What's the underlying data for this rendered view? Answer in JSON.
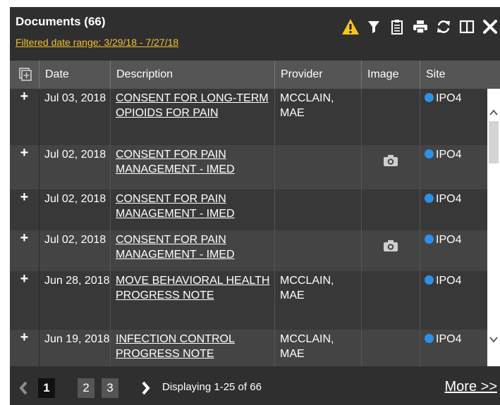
{
  "header": {
    "title": "Documents (66)",
    "filter_text": "Filtered date range: 3/29/18 - 7/27/18"
  },
  "toolbar": {
    "icons": [
      "warning-icon",
      "filter-icon",
      "clipboard-icon",
      "print-icon",
      "refresh-icon",
      "columns-icon",
      "close-icon"
    ],
    "warning_color": "#f5c518"
  },
  "columns": [
    "Date",
    "Description",
    "Provider",
    "Image",
    "Site"
  ],
  "rows": [
    {
      "expand": "+",
      "date": "Jul 03, 2018",
      "description": "CONSENT FOR LONG-TERM OPIOIDS FOR PAIN",
      "provider": "MCCLAIN, MAE",
      "has_image": false,
      "site": "IPO4"
    },
    {
      "expand": "+",
      "date": "Jul 02, 2018",
      "description": "CONSENT FOR PAIN MANAGEMENT - IMED",
      "provider": "",
      "has_image": true,
      "site": "IPO4"
    },
    {
      "expand": "+",
      "date": "Jul 02, 2018",
      "description": "CONSENT FOR PAIN MANAGEMENT - IMED",
      "provider": "",
      "has_image": false,
      "site": "IPO4"
    },
    {
      "expand": "+",
      "date": "Jul 02, 2018",
      "description": "CONSENT FOR PAIN MANAGEMENT - IMED",
      "provider": "",
      "has_image": true,
      "site": "IPO4"
    },
    {
      "expand": "+",
      "date": "Jun 28, 2018",
      "description": "MOVE BEHAVIORAL HEALTH PROGRESS NOTE",
      "provider": "MCCLAIN, MAE",
      "has_image": false,
      "site": "IPO4"
    },
    {
      "expand": "+",
      "date": "Jun 19, 2018",
      "description": "INFECTION CONTROL PROGRESS NOTE",
      "provider": "MCCLAIN, MAE",
      "has_image": false,
      "site": "IPO4"
    }
  ],
  "site_dot_color": "#2b90e8",
  "pagination": {
    "pages": [
      "1",
      "2",
      "3"
    ],
    "current": "1",
    "display_text": "Displaying 1-25 of 66",
    "more_label": "More >>"
  }
}
